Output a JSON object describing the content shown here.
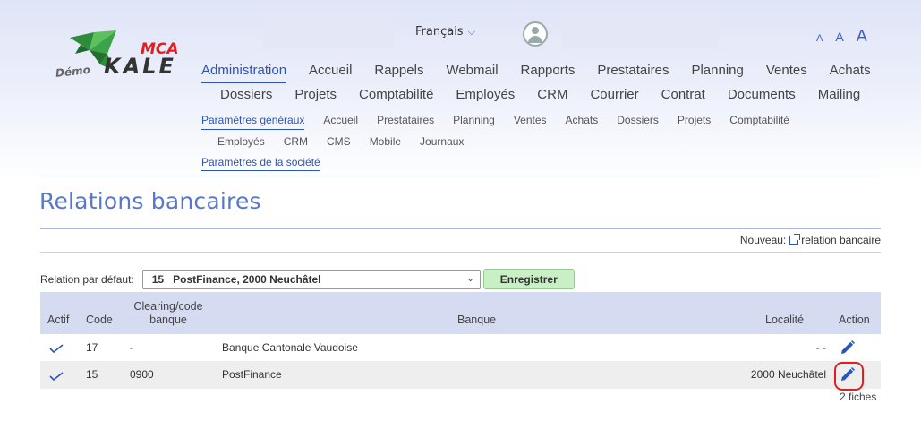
{
  "header": {
    "language": "Français",
    "font_sizes": [
      "A",
      "A",
      "A"
    ],
    "logo": {
      "brand_top": "MCA",
      "brand_main": "KALE",
      "brand_prefix": "Démo"
    }
  },
  "main_nav": {
    "row1": [
      "Administration",
      "Accueil",
      "Rappels",
      "Webmail",
      "Rapports",
      "Prestataires",
      "Planning",
      "Ventes",
      "Achats"
    ],
    "row2": [
      "Dossiers",
      "Projets",
      "Comptabilité",
      "Employés",
      "CRM",
      "Courrier",
      "Contrat",
      "Documents",
      "Mailing"
    ],
    "active": "Administration"
  },
  "sub_nav": {
    "row1": [
      "Paramètres généraux",
      "Accueil",
      "Prestataires",
      "Planning",
      "Ventes",
      "Achats",
      "Dossiers",
      "Projets",
      "Comptabilité"
    ],
    "row2": [
      "Employés",
      "CRM",
      "CMS",
      "Mobile",
      "Journaux"
    ],
    "active": "Paramètres généraux",
    "sub_sub": "Paramètres de la société"
  },
  "page": {
    "title": "Relations bancaires",
    "new_prefix": "Nouveau:",
    "new_link": "relation bancaire",
    "default_label": "Relation par défaut:",
    "default_value": "15   PostFinance, 2000 Neuchâtel",
    "save_button": "Enregistrer"
  },
  "table": {
    "headers": {
      "active": "Actif",
      "code": "Code",
      "clearing_l1": "Clearing/code",
      "clearing_l2": "banque",
      "bank": "Banque",
      "locality": "Localité",
      "action": "Action"
    },
    "rows": [
      {
        "active": true,
        "code": "17",
        "clearing": "-",
        "bank": "Banque Cantonale Vaudoise",
        "locality": "- -"
      },
      {
        "active": true,
        "code": "15",
        "clearing": "0900",
        "bank": "PostFinance",
        "locality": "2000 Neuchâtel"
      }
    ],
    "count": "2 fiches"
  },
  "colors": {
    "accent": "#2b55b8",
    "title": "#5a78c8",
    "header_bg": "#d5dcf2",
    "save_bg": "#c9f0c4",
    "highlight": "#e02020"
  }
}
